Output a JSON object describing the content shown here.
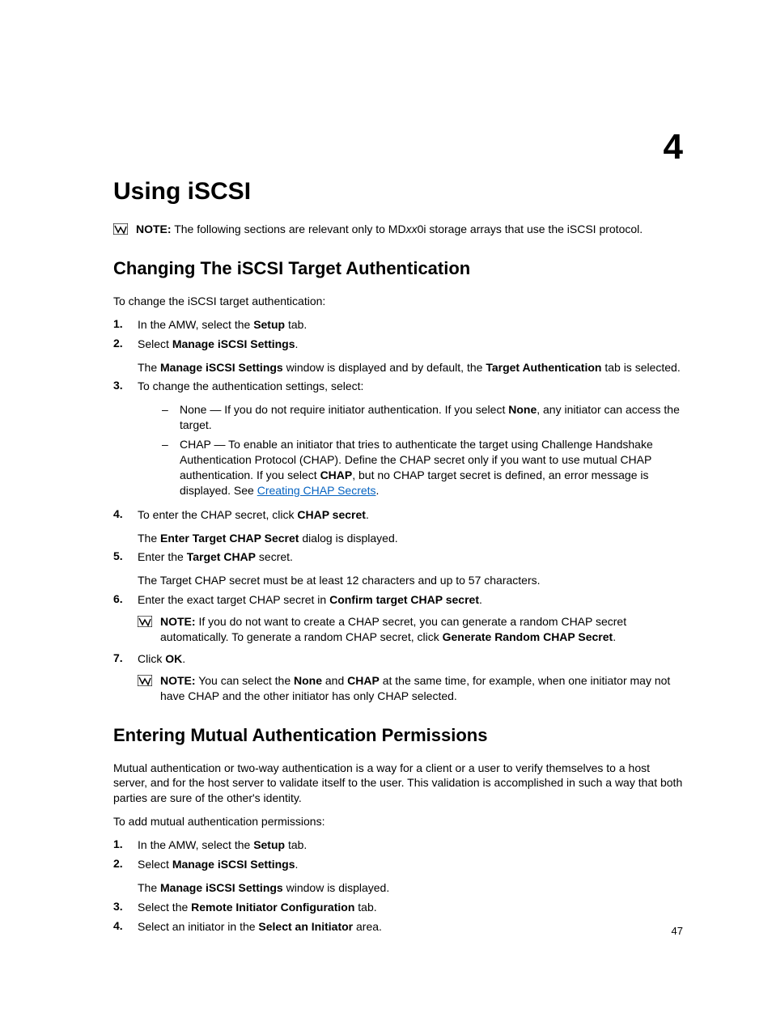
{
  "chapter_number": "4",
  "page_number": "47",
  "h1": "Using iSCSI",
  "top_note": {
    "label": "NOTE:",
    "text_pre": " The following sections are relevant only to MD",
    "text_italic": "xx",
    "text_post": "0i storage arrays that use the iSCSI protocol."
  },
  "section1": {
    "heading": "Changing The iSCSI Target Authentication",
    "intro": "To change the iSCSI target authentication:",
    "steps": [
      {
        "num": "1.",
        "line1_pre": "In the AMW, select the ",
        "line1_bold": "Setup",
        "line1_post": " tab."
      },
      {
        "num": "2.",
        "line1_pre": "Select ",
        "line1_bold": "Manage iSCSI Settings",
        "line1_post": ".",
        "line2_pre": "The ",
        "line2_bold1": "Manage iSCSI Settings",
        "line2_mid": " window is displayed and by default, the ",
        "line2_bold2": "Target Authentication",
        "line2_post": " tab is selected."
      },
      {
        "num": "3.",
        "line1": "To change the authentication settings, select:",
        "sub": [
          {
            "dash": "–",
            "pre": "None — If you do not require initiator authentication. If you select ",
            "bold": "None",
            "post": ", any initiator can access the target."
          },
          {
            "dash": "–",
            "pre": "CHAP — To enable an initiator that tries to authenticate the target using Challenge Handshake Authentication Protocol (CHAP). Define the CHAP secret only if you want to use mutual CHAP authentication. If you select ",
            "bold": "CHAP",
            "mid": ", but no CHAP target secret is defined, an error message is displayed. See ",
            "link": "Creating CHAP Secrets",
            "post": "."
          }
        ]
      },
      {
        "num": "4.",
        "line1_pre": "To enter the CHAP secret, click ",
        "line1_bold": "CHAP secret",
        "line1_post": ".",
        "line2_pre": "The ",
        "line2_bold": "Enter Target CHAP Secret",
        "line2_post": " dialog is displayed."
      },
      {
        "num": "5.",
        "line1_pre": "Enter the ",
        "line1_bold": "Target CHAP",
        "line1_post": " secret.",
        "line2": "The Target CHAP secret must be at least 12 characters and up to 57 characters."
      },
      {
        "num": "6.",
        "line1_pre": "Enter the exact target CHAP secret in ",
        "line1_bold": "Confirm target CHAP secret",
        "line1_post": ".",
        "note": {
          "label": "NOTE:",
          "pre": " If you do not want to create a CHAP secret, you can generate a random CHAP secret automatically. To generate a random CHAP secret, click ",
          "bold": "Generate Random CHAP Secret",
          "post": "."
        }
      },
      {
        "num": "7.",
        "line1_pre": "Click ",
        "line1_bold": "OK",
        "line1_post": ".",
        "note": {
          "label": "NOTE:",
          "pre": " You can select the ",
          "bold1": "None",
          "mid": " and ",
          "bold2": "CHAP",
          "post": " at the same time, for example, when one initiator may not have CHAP and the other initiator has only CHAP selected."
        }
      }
    ]
  },
  "section2": {
    "heading": "Entering Mutual Authentication Permissions",
    "para1": "Mutual authentication or two-way authentication is a way for a client or a user to verify themselves to a host server, and for the host server to validate itself to the user. This validation is accomplished in such a way that both parties are sure of the other's identity.",
    "para2": "To add mutual authentication permissions:",
    "steps": [
      {
        "num": "1.",
        "pre": "In the AMW, select the ",
        "bold": "Setup",
        "post": " tab."
      },
      {
        "num": "2.",
        "pre": "Select ",
        "bold": "Manage iSCSI Settings",
        "post": ".",
        "line2_pre": "The ",
        "line2_bold": "Manage iSCSI Settings",
        "line2_post": " window is displayed."
      },
      {
        "num": "3.",
        "pre": "Select the ",
        "bold": "Remote Initiator Configuration",
        "post": " tab."
      },
      {
        "num": "4.",
        "pre": "Select an initiator in the ",
        "bold": "Select an Initiator",
        "post": " area."
      }
    ]
  }
}
